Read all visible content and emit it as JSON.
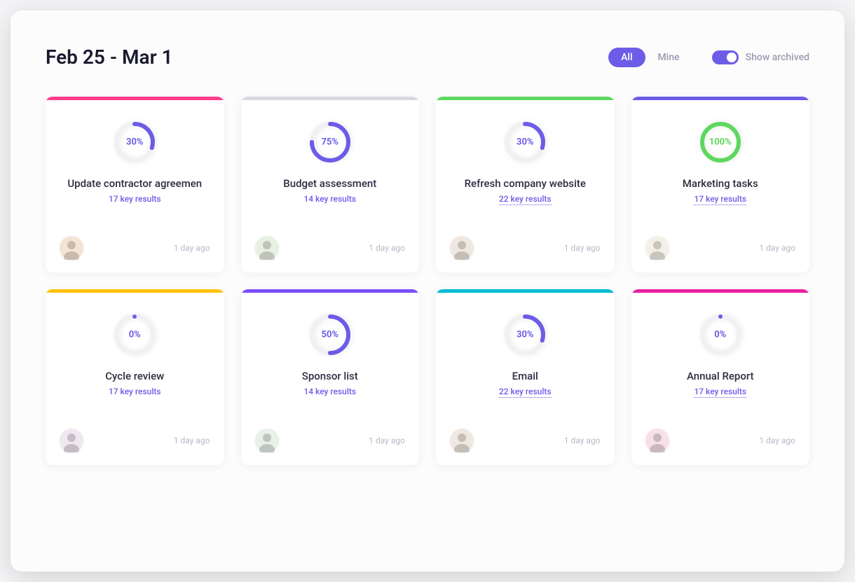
{
  "header": {
    "date_range": "Feb 25 - Mar 1",
    "filters": {
      "all": "All",
      "mine": "Mine"
    },
    "toggle": {
      "label": "Show archived"
    }
  },
  "cards": [
    {
      "stripe": "#ff3b8b",
      "progress": 30,
      "progress_text": "30%",
      "ring_color": "#6c5ce7",
      "text_color": "#6c5ce7",
      "title": "Update contractor agreemen",
      "results": "17 key results",
      "dotted": false,
      "timestamp": "1 day ago",
      "avatar_bg": "#f4e4d4"
    },
    {
      "stripe": "#d8d8e0",
      "progress": 75,
      "progress_text": "75%",
      "ring_color": "#6c5ce7",
      "text_color": "#6c5ce7",
      "title": "Budget assessment",
      "results": "14 key results",
      "dotted": false,
      "timestamp": "1 day ago",
      "avatar_bg": "#e8f0e0"
    },
    {
      "stripe": "#5dd85d",
      "progress": 30,
      "progress_text": "30%",
      "ring_color": "#6c5ce7",
      "text_color": "#6c5ce7",
      "title": "Refresh company website",
      "results": "22 key results",
      "dotted": true,
      "timestamp": "1 day ago",
      "avatar_bg": "#f0e8e0"
    },
    {
      "stripe": "#6c5ce7",
      "progress": 100,
      "progress_text": "100%",
      "ring_color": "#5dd85d",
      "text_color": "#5dd85d",
      "title": "Marketing tasks",
      "results": "17 key results",
      "dotted": true,
      "timestamp": "1 day ago",
      "avatar_bg": "#f4f0e8"
    },
    {
      "stripe": "#ffc107",
      "progress": 0,
      "progress_text": "0%",
      "ring_color": "#6c5ce7",
      "text_color": "#6c5ce7",
      "title": "Cycle review",
      "results": "17 key results",
      "dotted": false,
      "timestamp": "1 day ago",
      "avatar_bg": "#f0e8f0"
    },
    {
      "stripe": "#7c4dff",
      "progress": 50,
      "progress_text": "50%",
      "ring_color": "#6c5ce7",
      "text_color": "#6c5ce7",
      "title": "Sponsor list",
      "results": "14 key results",
      "dotted": false,
      "timestamp": "1 day ago",
      "avatar_bg": "#e8f0e8"
    },
    {
      "stripe": "#00bcd4",
      "progress": 30,
      "progress_text": "30%",
      "ring_color": "#6c5ce7",
      "text_color": "#6c5ce7",
      "title": "Email",
      "results": "22 key results",
      "dotted": true,
      "timestamp": "1 day ago",
      "avatar_bg": "#f0e8e0"
    },
    {
      "stripe": "#e91e9e",
      "progress": 0,
      "progress_text": "0%",
      "ring_color": "#6c5ce7",
      "text_color": "#6c5ce7",
      "title": "Annual Report",
      "results": "17 key results",
      "dotted": true,
      "timestamp": "1 day ago",
      "avatar_bg": "#f8e0e8"
    }
  ]
}
